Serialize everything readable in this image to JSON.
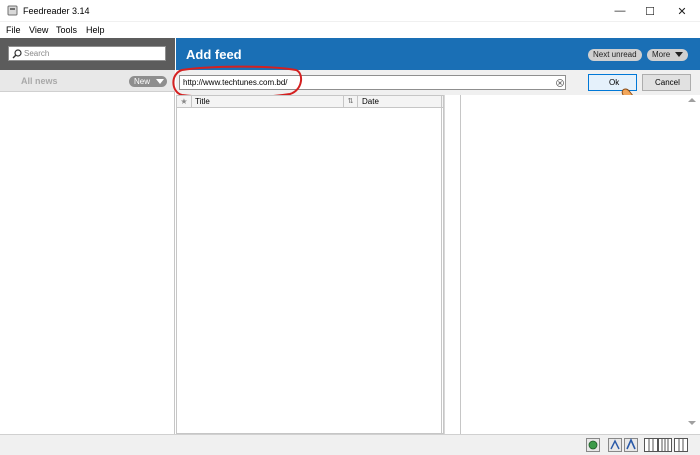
{
  "window": {
    "title": "Feedreader 3.14",
    "minimize_glyph": "—",
    "maximize_glyph": "☐",
    "close_glyph": "✕"
  },
  "menu": {
    "items": [
      {
        "label": "File"
      },
      {
        "label": "View"
      },
      {
        "label": "Tools"
      },
      {
        "label": "Help"
      }
    ]
  },
  "sidebar": {
    "search_placeholder": "Search",
    "all_news_label": "All news",
    "new_button_label": "New"
  },
  "main": {
    "title": "Add feed",
    "next_unread_label": "Next unread",
    "more_label": "More"
  },
  "add_feed": {
    "url_value": "http://www.techtunes.com.bd/",
    "ok_label": "Ok",
    "cancel_label": "Cancel"
  },
  "article_list": {
    "columns": {
      "star": "★",
      "title": "Title",
      "sort": "⇅",
      "date": "Date"
    }
  },
  "colors": {
    "header_blue": "#1a6fb5",
    "sidebar_dark": "#5c5c5c",
    "annotation_red": "#d42020",
    "ok_border": "#0078d7"
  },
  "icons": {
    "app": "feedreader-app-icon",
    "search": "search-icon",
    "clear": "clear-input-icon",
    "cursor": "hand-pointer-icon",
    "status": [
      "refresh-icon",
      "font-size-icon",
      "layout-icon"
    ]
  }
}
